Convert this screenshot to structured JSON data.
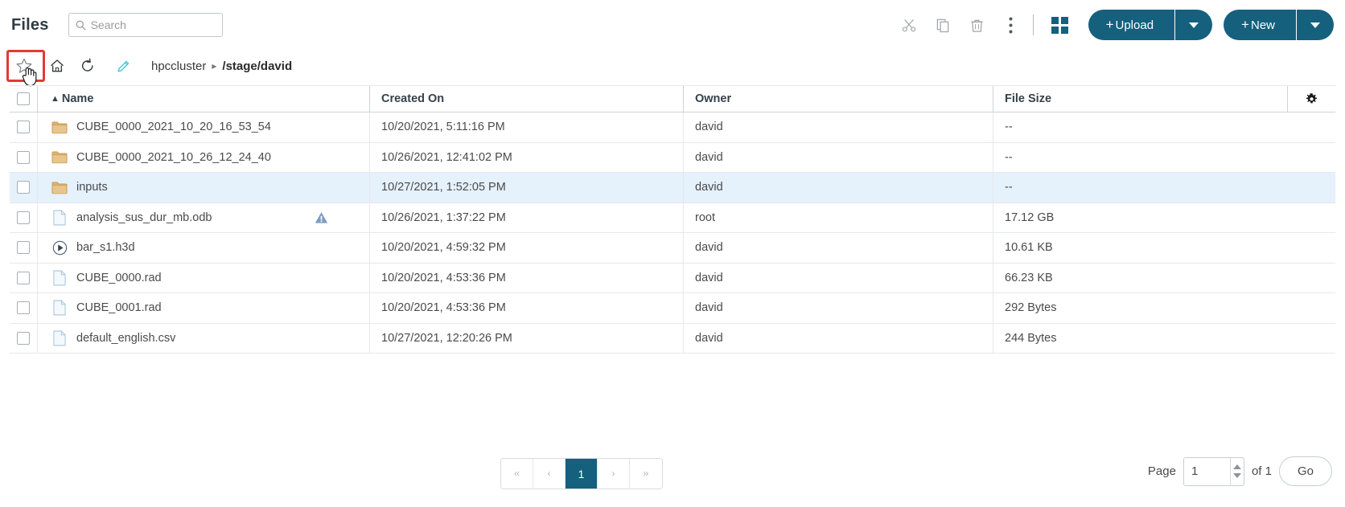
{
  "header": {
    "title": "Files",
    "search": {
      "placeholder": "Search",
      "value": "",
      "icon": "search-icon"
    },
    "actions": [
      {
        "name": "cut",
        "icon": "scissors-icon",
        "label": "Cut"
      },
      {
        "name": "copy",
        "icon": "copy-icon",
        "label": "Copy"
      },
      {
        "name": "delete",
        "icon": "trash-icon",
        "label": "Delete"
      },
      {
        "name": "more",
        "icon": "vertical-dots-icon",
        "label": "More"
      }
    ],
    "view_toggle": {
      "name": "grid-view",
      "icon": "grid-icon"
    },
    "upload_button": {
      "label": "Upload",
      "plus": "+",
      "caret": "caret-down-icon"
    },
    "new_button": {
      "label": "New",
      "plus": "+",
      "caret": "caret-down-icon"
    }
  },
  "breadcrumb": {
    "star": {
      "icon": "star-icon",
      "highlighted": true
    },
    "home": {
      "icon": "home-icon"
    },
    "refresh": {
      "icon": "refresh-icon"
    },
    "edit": {
      "icon": "pencil-icon"
    },
    "root": "hpccluster",
    "separator": "▸",
    "current": "/stage/david"
  },
  "table": {
    "columns": [
      {
        "key": "name",
        "label": "Name",
        "sort": "▲"
      },
      {
        "key": "created",
        "label": "Created On"
      },
      {
        "key": "owner",
        "label": "Owner"
      },
      {
        "key": "size",
        "label": "File Size"
      }
    ],
    "settings_icon": "gear-icon",
    "rows": [
      {
        "icon": "folder-icon",
        "name": "CUBE_0000_2021_10_20_16_53_54",
        "created": "10/20/2021, 5:11:16 PM",
        "owner": "david",
        "size": "--",
        "selected": false,
        "warning": false
      },
      {
        "icon": "folder-icon",
        "name": "CUBE_0000_2021_10_26_12_24_40",
        "created": "10/26/2021, 12:41:02 PM",
        "owner": "david",
        "size": "--",
        "selected": false,
        "warning": false
      },
      {
        "icon": "folder-icon",
        "name": "inputs",
        "created": "10/27/2021, 1:52:05 PM",
        "owner": "david",
        "size": "--",
        "selected": true,
        "warning": false
      },
      {
        "icon": "file-icon",
        "name": "analysis_sus_dur_mb.odb",
        "created": "10/26/2021, 1:37:22 PM",
        "owner": "root",
        "size": "17.12 GB",
        "selected": false,
        "warning": true
      },
      {
        "icon": "play-icon",
        "name": "bar_s1.h3d",
        "created": "10/20/2021, 4:59:32 PM",
        "owner": "david",
        "size": "10.61 KB",
        "selected": false,
        "warning": false
      },
      {
        "icon": "file-icon",
        "name": "CUBE_0000.rad",
        "created": "10/20/2021, 4:53:36 PM",
        "owner": "david",
        "size": "66.23 KB",
        "selected": false,
        "warning": false
      },
      {
        "icon": "file-icon",
        "name": "CUBE_0001.rad",
        "created": "10/20/2021, 4:53:36 PM",
        "owner": "david",
        "size": "292 Bytes",
        "selected": false,
        "warning": false
      },
      {
        "icon": "file-icon",
        "name": "default_english.csv",
        "created": "10/27/2021, 12:20:26 PM",
        "owner": "david",
        "size": "244 Bytes",
        "selected": false,
        "warning": false
      }
    ]
  },
  "pagination": {
    "first": "«",
    "prev": "‹",
    "pages": [
      "1"
    ],
    "active_page": "1",
    "next": "›",
    "last": "»",
    "page_label": "Page",
    "page_value": "1",
    "of_label": "of 1",
    "go_label": "Go"
  },
  "colors": {
    "accent": "#15607d",
    "selected_row": "#e5f1fb",
    "highlight_box": "#e23b33",
    "folder": "#dcb069",
    "pencil": "#4dc8e0",
    "warning": "#7b9dc4"
  }
}
